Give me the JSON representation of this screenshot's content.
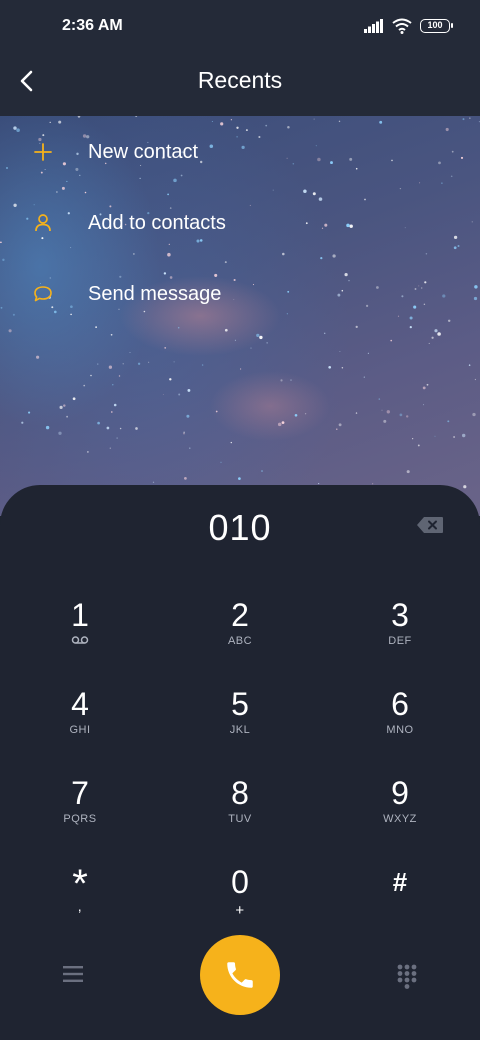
{
  "status_bar": {
    "time": "2:36 AM",
    "battery": "100"
  },
  "header": {
    "title": "Recents"
  },
  "actions": [
    {
      "label": "New contact",
      "icon": "plus-icon"
    },
    {
      "label": "Add to contacts",
      "icon": "person-icon"
    },
    {
      "label": "Send message",
      "icon": "message-icon"
    }
  ],
  "dialer": {
    "number": "010",
    "keys": [
      {
        "digit": "1",
        "sub": "voicemail-icon"
      },
      {
        "digit": "2",
        "sub": "ABC"
      },
      {
        "digit": "3",
        "sub": "DEF"
      },
      {
        "digit": "4",
        "sub": "GHI"
      },
      {
        "digit": "5",
        "sub": "JKL"
      },
      {
        "digit": "6",
        "sub": "MNO"
      },
      {
        "digit": "7",
        "sub": "PQRS"
      },
      {
        "digit": "8",
        "sub": "TUV"
      },
      {
        "digit": "9",
        "sub": "WXYZ"
      },
      {
        "digit": "*",
        "sub": ","
      },
      {
        "digit": "0",
        "sub": "+"
      },
      {
        "digit": "#",
        "sub": ""
      }
    ]
  },
  "colors": {
    "accent": "#f6b21b",
    "background": "#1f2431",
    "header": "#242a38"
  }
}
